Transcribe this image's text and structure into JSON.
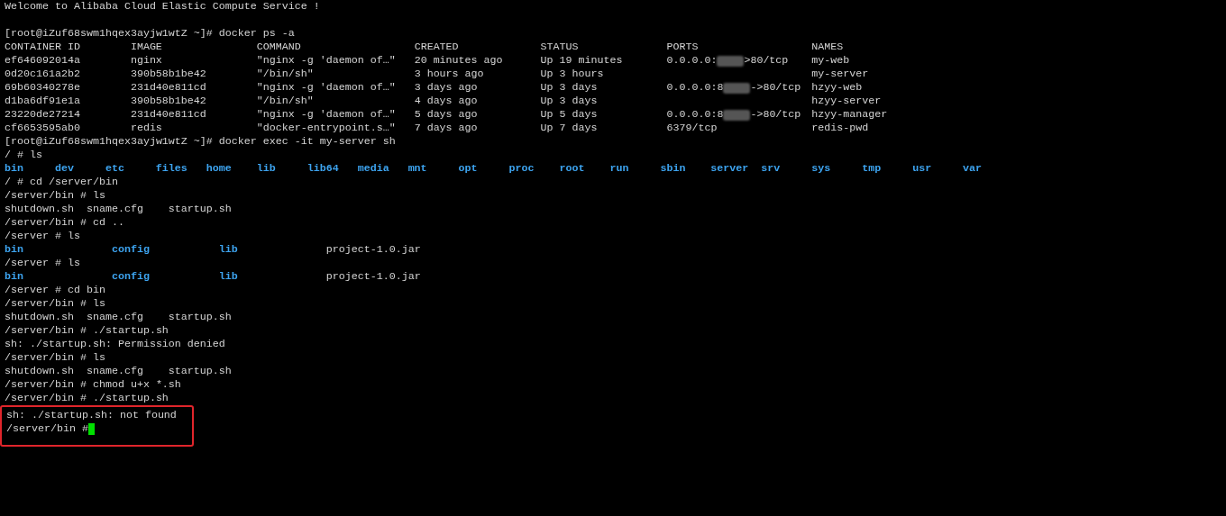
{
  "terminal": {
    "lines": [
      {
        "kind": "text",
        "text": "Welcome to Alibaba Cloud Elastic Compute Service !"
      },
      {
        "kind": "blank"
      },
      {
        "kind": "text",
        "text": "[root@iZuf68swm1hqex3ayjw1wtZ ~]# docker ps -a"
      },
      {
        "kind": "table",
        "columns": [
          "CONTAINER ID",
          "IMAGE",
          "COMMAND",
          "CREATED",
          "STATUS",
          "PORTS",
          "NAMES"
        ],
        "rows": [
          {
            "cells": [
              "ef646092014a",
              "nginx",
              "\"nginx -g 'daemon of…\"",
              "20 minutes ago",
              "Up 19 minutes"
            ],
            "port": {
              "before": "0.0.0.0:",
              "after": ">80/tcp"
            },
            "name": "my-web"
          },
          {
            "cells": [
              "0d20c161a2b2",
              "390b58b1be42",
              "\"/bin/sh\"",
              "3 hours ago",
              "Up 3 hours"
            ],
            "name": "my-server"
          },
          {
            "cells": [
              "69b60340278e",
              "231d40e811cd",
              "\"nginx -g 'daemon of…\"",
              "3 days ago",
              "Up 3 days"
            ],
            "port": {
              "before": "0.0.0.0:8",
              "after": "->80/tcp"
            },
            "name": "hzyy-web"
          },
          {
            "cells": [
              "d1ba6df91e1a",
              "390b58b1be42",
              "\"/bin/sh\"",
              "4 days ago",
              "Up 3 days"
            ],
            "name": "hzyy-server"
          },
          {
            "cells": [
              "23220de27214",
              "231d40e811cd",
              "\"nginx -g 'daemon of…\"",
              "5 days ago",
              "Up 5 days"
            ],
            "port": {
              "before": "0.0.0.0:8",
              "after": "->80/tcp"
            },
            "name": "hzyy-manager"
          },
          {
            "cells": [
              "cf6653595ab0",
              "redis",
              "\"docker-entrypoint.s…\"",
              "7 days ago",
              "Up 7 days"
            ],
            "port": {
              "before": "6379/tcp"
            },
            "name": "redis-pwd"
          }
        ]
      },
      {
        "kind": "text",
        "text": "[root@iZuf68swm1hqex3ayjw1wtZ ~]# docker exec -it my-server sh"
      },
      {
        "kind": "text",
        "text": "/ # ls"
      },
      {
        "kind": "ls",
        "entries": [
          {
            "name": "bin",
            "kind": "dir"
          },
          {
            "name": "dev",
            "kind": "dir"
          },
          {
            "name": "etc",
            "kind": "dir"
          },
          {
            "name": "files",
            "kind": "dir"
          },
          {
            "name": "home",
            "kind": "dir"
          },
          {
            "name": "lib",
            "kind": "dir"
          },
          {
            "name": "lib64",
            "kind": "dir"
          },
          {
            "name": "media",
            "kind": "dir"
          },
          {
            "name": "mnt",
            "kind": "dir"
          },
          {
            "name": "opt",
            "kind": "dir"
          },
          {
            "name": "proc",
            "kind": "dir"
          },
          {
            "name": "root",
            "kind": "dir"
          },
          {
            "name": "run",
            "kind": "dir"
          },
          {
            "name": "sbin",
            "kind": "dir"
          },
          {
            "name": "server",
            "kind": "dir"
          },
          {
            "name": "srv",
            "kind": "dir"
          },
          {
            "name": "sys",
            "kind": "dir"
          },
          {
            "name": "tmp",
            "kind": "dir"
          },
          {
            "name": "usr",
            "kind": "dir"
          },
          {
            "name": "var",
            "kind": "dir"
          }
        ]
      },
      {
        "kind": "text",
        "text": "/ # cd /server/bin"
      },
      {
        "kind": "text",
        "text": "/server/bin # ls"
      },
      {
        "kind": "text",
        "text": "shutdown.sh  sname.cfg    startup.sh"
      },
      {
        "kind": "text",
        "text": "/server/bin # cd .."
      },
      {
        "kind": "text",
        "text": "/server # ls"
      },
      {
        "kind": "ls",
        "entries": [
          {
            "name": "bin",
            "kind": "dir"
          },
          {
            "name": "config",
            "kind": "dir"
          },
          {
            "name": "lib",
            "kind": "dir"
          },
          {
            "name": "project-1.0.jar",
            "kind": "file"
          }
        ]
      },
      {
        "kind": "text",
        "text": "/server # ls"
      },
      {
        "kind": "ls",
        "entries": [
          {
            "name": "bin",
            "kind": "dir"
          },
          {
            "name": "config",
            "kind": "dir"
          },
          {
            "name": "lib",
            "kind": "dir"
          },
          {
            "name": "project-1.0.jar",
            "kind": "file"
          }
        ]
      },
      {
        "kind": "text",
        "text": "/server # cd bin"
      },
      {
        "kind": "text",
        "text": "/server/bin # ls"
      },
      {
        "kind": "text",
        "text": "shutdown.sh  sname.cfg    startup.sh"
      },
      {
        "kind": "text",
        "text": "/server/bin # ./startup.sh"
      },
      {
        "kind": "text",
        "text": "sh: ./startup.sh: Permission denied"
      },
      {
        "kind": "text",
        "text": "/server/bin # ls"
      },
      {
        "kind": "text",
        "text": "shutdown.sh  sname.cfg    startup.sh"
      },
      {
        "kind": "text",
        "text": "/server/bin # chmod u+x *.sh"
      },
      {
        "kind": "text",
        "text": "/server/bin # ./startup.sh"
      }
    ],
    "highlighted_lines": [
      {
        "kind": "text",
        "text": "sh: ./startup.sh: not found"
      },
      {
        "kind": "input",
        "text": "/server/bin #"
      }
    ]
  }
}
